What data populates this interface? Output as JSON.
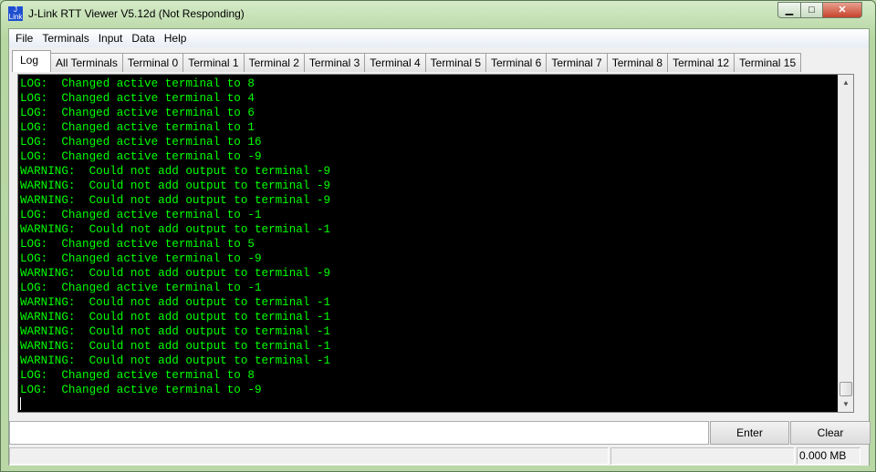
{
  "window": {
    "title": "J-Link RTT Viewer V5.12d (Not Responding)",
    "icon": "jlink-logo-icon",
    "min": "minimize-icon",
    "max": "maximize-icon",
    "close": "close-icon"
  },
  "menu": [
    "File",
    "Terminals",
    "Input",
    "Data",
    "Help"
  ],
  "tabs": [
    "Log",
    "All Terminals",
    "Terminal 0",
    "Terminal 1",
    "Terminal 2",
    "Terminal 3",
    "Terminal 4",
    "Terminal 5",
    "Terminal 6",
    "Terminal 7",
    "Terminal 8",
    "Terminal 12",
    "Terminal 15"
  ],
  "active_tab": "Log",
  "log_lines": [
    "LOG:  Changed active terminal to 8",
    "LOG:  Changed active terminal to 4",
    "LOG:  Changed active terminal to 6",
    "LOG:  Changed active terminal to 1",
    "LOG:  Changed active terminal to 16",
    "LOG:  Changed active terminal to -9",
    "WARNING:  Could not add output to terminal -9",
    "WARNING:  Could not add output to terminal -9",
    "WARNING:  Could not add output to terminal -9",
    "LOG:  Changed active terminal to -1",
    "WARNING:  Could not add output to terminal -1",
    "LOG:  Changed active terminal to 5",
    "LOG:  Changed active terminal to -9",
    "WARNING:  Could not add output to terminal -9",
    "LOG:  Changed active terminal to -1",
    "WARNING:  Could not add output to terminal -1",
    "WARNING:  Could not add output to terminal -1",
    "WARNING:  Could not add output to terminal -1",
    "WARNING:  Could not add output to terminal -1",
    "WARNING:  Could not add output to terminal -1",
    "LOG:  Changed active terminal to 8",
    "LOG:  Changed active terminal to -9"
  ],
  "colors": {
    "terminal_bg": "#000000",
    "terminal_text": "#00ff00"
  },
  "input": {
    "value": "",
    "enter_label": "Enter",
    "clear_label": "Clear"
  },
  "status": {
    "size": "0.000 MB"
  }
}
